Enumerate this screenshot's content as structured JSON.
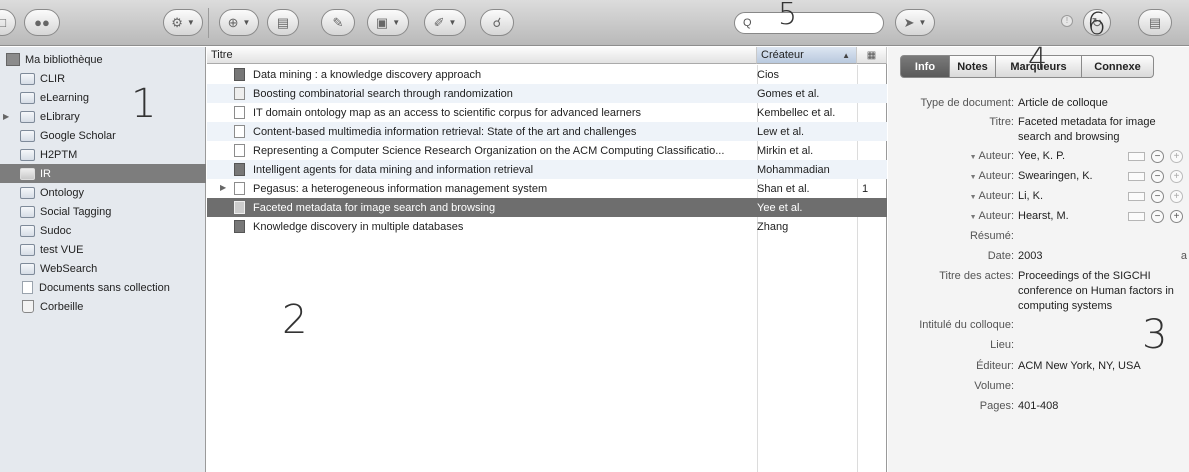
{
  "toolbar": {
    "search_placeholder": "",
    "buttons": [
      {
        "name": "new-collection-button",
        "icon": "folder-icon"
      },
      {
        "name": "new-group-button",
        "icon": "group-icon"
      },
      {
        "name": "actions-menu-button",
        "icon": "gear-icon"
      },
      {
        "name": "new-item-button",
        "icon": "plus-icon"
      },
      {
        "name": "new-item-from-page-button",
        "icon": "page-icon"
      },
      {
        "name": "add-by-identifier-button",
        "icon": "wand-icon"
      },
      {
        "name": "create-note-button",
        "icon": "note-icon"
      },
      {
        "name": "add-attachment-button",
        "icon": "paperclip-icon"
      },
      {
        "name": "advanced-search-button",
        "icon": "magnifier-icon"
      },
      {
        "name": "locate-button",
        "icon": "arrow-icon"
      },
      {
        "name": "sync-button",
        "icon": "sync-icon"
      },
      {
        "name": "fullscreen-button",
        "icon": "fullscreen-icon"
      }
    ],
    "sync_indicator": "!"
  },
  "callouts": {
    "n1": "1",
    "n2": "2",
    "n3": "3",
    "n4": "4",
    "n5": "5",
    "n6": "6"
  },
  "collections": [
    {
      "label": "Ma bibliothèque",
      "type": "library"
    },
    {
      "label": "CLIR",
      "type": "folder"
    },
    {
      "label": "eLearning",
      "type": "folder"
    },
    {
      "label": "eLibrary",
      "type": "folder",
      "expandable": true
    },
    {
      "label": "Google Scholar",
      "type": "folder"
    },
    {
      "label": "H2PTM",
      "type": "folder"
    },
    {
      "label": "IR",
      "type": "folder",
      "selected": true
    },
    {
      "label": "Ontology",
      "type": "folder"
    },
    {
      "label": "Social Tagging",
      "type": "folder"
    },
    {
      "label": "Sudoc",
      "type": "folder"
    },
    {
      "label": "test VUE",
      "type": "folder"
    },
    {
      "label": "WebSearch",
      "type": "folder"
    },
    {
      "label": "Documents sans collection",
      "type": "unfiled"
    },
    {
      "label": "Corbeille",
      "type": "trash"
    }
  ],
  "items_table": {
    "columns": {
      "title": "Titre",
      "creator": "Créateur"
    },
    "rows": [
      {
        "title": "Data mining : a knowledge discovery approach",
        "creator": "Cios",
        "extra": "",
        "icon": "book"
      },
      {
        "title": "Boosting combinatorial search through randomization",
        "creator": "Gomes et al.",
        "extra": "",
        "icon": "attachment"
      },
      {
        "title": "IT domain ontology map as an access to scientific corpus for advanced learners",
        "creator": "Kembellec et al.",
        "extra": "",
        "icon": "document"
      },
      {
        "title": "Content-based multimedia information retrieval: State of the art and challenges",
        "creator": "Lew et al.",
        "extra": "",
        "icon": "document"
      },
      {
        "title": "Representing a Computer Science Research Organization on the ACM Computing Classificatio...",
        "creator": "Mirkin et al.",
        "extra": "",
        "icon": "document"
      },
      {
        "title": "Intelligent agents for data mining and information retrieval",
        "creator": "Mohammadian",
        "extra": "",
        "icon": "book"
      },
      {
        "title": "Pegasus: a heterogeneous information management system",
        "creator": "Shan et al.",
        "extra": "1",
        "icon": "document",
        "expandable": true
      },
      {
        "title": "Faceted metadata for image search and browsing",
        "creator": "Yee et al.",
        "extra": "",
        "icon": "conference",
        "selected": true
      },
      {
        "title": "Knowledge discovery in multiple databases",
        "creator": "Zhang",
        "extra": "",
        "icon": "book"
      }
    ]
  },
  "item_pane": {
    "tabs": [
      "Info",
      "Notes",
      "Marqueurs",
      "Connexe"
    ],
    "active_tab": "Info",
    "fields": {
      "type_label": "Type de document:",
      "type_value": "Article de colloque",
      "title_label": "Titre:",
      "title_value": "Faceted metadata for image search and browsing",
      "author_label": "Auteur:",
      "authors": [
        "Yee, K. P.",
        "Swearingen, K.",
        "Li, K.",
        "Hearst, M."
      ],
      "abstract_label": "Résumé:",
      "abstract_value": "",
      "date_label": "Date:",
      "date_value": "2003",
      "date_suffix": "a",
      "proceedings_label": "Titre des actes:",
      "proceedings_value": "Proceedings of the SIGCHI conference on Human factors in computing systems",
      "conference_label": "Intitulé du colloque:",
      "conference_value": "",
      "place_label": "Lieu:",
      "place_value": "",
      "publisher_label": "Éditeur:",
      "publisher_value": "ACM New York, NY, USA",
      "volume_label": "Volume:",
      "volume_value": "",
      "pages_label": "Pages:",
      "pages_value": "401-408"
    }
  }
}
